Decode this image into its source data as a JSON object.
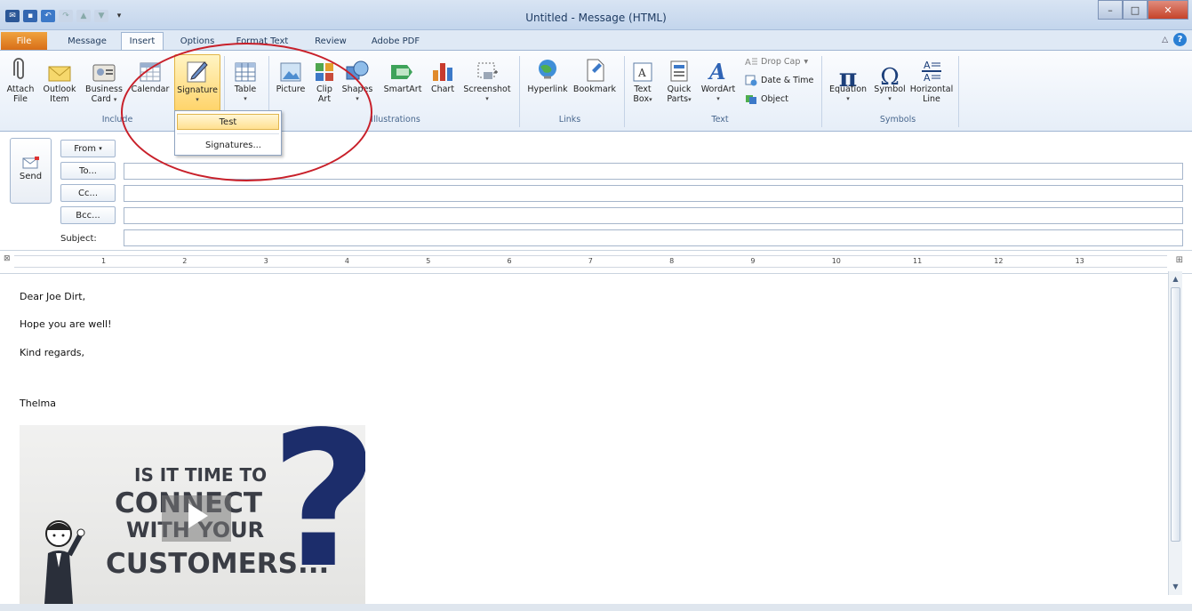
{
  "window": {
    "title": "Untitled - Message (HTML)"
  },
  "tabs": {
    "file": "File",
    "message": "Message",
    "insert": "Insert",
    "options": "Options",
    "format_text": "Format Text",
    "review": "Review",
    "adobe_pdf": "Adobe PDF"
  },
  "ribbon": {
    "include": {
      "attach_file": "Attach\nFile",
      "attach_file_l1": "Attach",
      "attach_file_l2": "File",
      "outlook_item_l1": "Outlook",
      "outlook_item_l2": "Item",
      "business_card_l1": "Business",
      "business_card_l2": "Card",
      "calendar": "Calendar",
      "signature": "Signature",
      "label": "Include"
    },
    "tables": {
      "table": "Table"
    },
    "illustrations": {
      "picture": "Picture",
      "clip_art_l1": "Clip",
      "clip_art_l2": "Art",
      "shapes": "Shapes",
      "smartart": "SmartArt",
      "chart": "Chart",
      "screenshot": "Screenshot",
      "label": "Illustrations"
    },
    "links": {
      "hyperlink": "Hyperlink",
      "bookmark": "Bookmark",
      "label": "Links"
    },
    "text": {
      "text_box_l1": "Text",
      "text_box_l2": "Box",
      "quick_parts_l1": "Quick",
      "quick_parts_l2": "Parts",
      "wordart": "WordArt",
      "drop_cap": "Drop Cap",
      "date_time": "Date & Time",
      "object": "Object",
      "label": "Text"
    },
    "symbols": {
      "equation": "Equation",
      "symbol": "Symbol",
      "horizontal_line_l1": "Horizontal",
      "horizontal_line_l2": "Line",
      "label": "Symbols"
    }
  },
  "signature_menu": {
    "item": "Test",
    "manage": "Signatures..."
  },
  "header": {
    "send": "Send",
    "from": "From",
    "to": "To...",
    "cc": "Cc...",
    "bcc": "Bcc...",
    "subject": "Subject:",
    "to_value": "",
    "cc_value": "",
    "bcc_value": "",
    "subject_value": ""
  },
  "ruler": {
    "marks": [
      "1",
      "2",
      "3",
      "4",
      "5",
      "6",
      "7",
      "8",
      "9",
      "10",
      "11",
      "12",
      "13"
    ]
  },
  "body": {
    "greeting": "Dear Joe Dirt,",
    "line1": "Hope you are well!",
    "closing": "Kind regards,",
    "name": "Thelma"
  },
  "signature_image": {
    "line1": "IS IT TIME TO",
    "line2": "CONNECT",
    "line3": "WITH YOUR",
    "line4": "CUSTOMERS...",
    "mark": "?"
  },
  "colors": {
    "accent": "#1e395b",
    "file_tab": "#e0761f",
    "annotation": "#c8202a",
    "navy": "#1c2d6b"
  }
}
